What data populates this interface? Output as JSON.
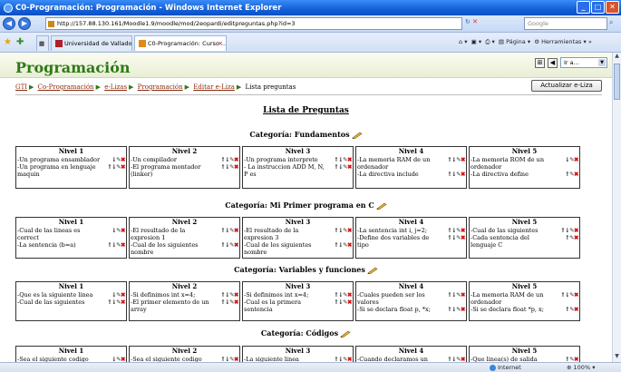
{
  "window": {
    "title": "C0-Programación: Programación - Windows Internet Explorer"
  },
  "address": {
    "url": "http://157.88.130.161/Moodle1.9/moodle/mod/2eopardi/editpreguntas.php?id=3",
    "search_placeholder": "Google"
  },
  "tabs": [
    {
      "label": "Universidad de Valladolid"
    },
    {
      "label": "C0-Programación: Curso ..."
    }
  ],
  "toolbar": {
    "page_label": "Página",
    "tools_label": "Herramientas"
  },
  "header": {
    "course_title": "Programación",
    "jump_select": "Ir a..."
  },
  "breadcrumb": {
    "items": [
      "GTI",
      "Co-Programación",
      "e-Lizas",
      "Programación",
      "Editar e-Liza"
    ],
    "current": "Lista preguntas"
  },
  "update_button": "Actualizar e-Liza",
  "list_title": "Lista de Preguntas",
  "status": {
    "zone": "Internet",
    "zoom": "100%"
  },
  "categories": [
    {
      "title": "Categoría: Fundamentos",
      "levels": [
        {
          "name": "Nivel 1",
          "questions": [
            "-Un programa ensamblador",
            "-Un programa en lenguaje maquin"
          ]
        },
        {
          "name": "Nivel 2",
          "questions": [
            "-Un compilador",
            "-El programa montador (linker)"
          ]
        },
        {
          "name": "Nivel 3",
          "questions": [
            "-Un programa interprete",
            "- La instruccion ADD M, N, P es"
          ]
        },
        {
          "name": "Nivel 4",
          "questions": [
            "-La memoria RAM de un ordenador",
            "-La directiva include"
          ]
        },
        {
          "name": "Nivel 5",
          "questions": [
            "-La memoria ROM de un ordenador",
            "-La directiva define"
          ]
        }
      ]
    },
    {
      "title": "Categoría: Mi Primer programa en C",
      "levels": [
        {
          "name": "Nivel 1",
          "questions": [
            "-Cual de las lineas es correct",
            "-La sentencia (b=a)"
          ]
        },
        {
          "name": "Nivel 2",
          "questions": [
            "-El resultado de la expresion 1",
            "-Cual de los siguientes nombre"
          ]
        },
        {
          "name": "Nivel 3",
          "questions": [
            "-El resultado de la expresion 3",
            "-Cual de los siguientes nombre"
          ]
        },
        {
          "name": "Nivel 4",
          "questions": [
            "-La sentencia int i, j=2;",
            "-Define dos variables de tipo"
          ]
        },
        {
          "name": "Nivel 5",
          "questions": [
            "-Cual de las siguientes",
            "-Cada sentencia del lenguaje C"
          ]
        }
      ]
    },
    {
      "title": "Categoría: Variables y funciones",
      "levels": [
        {
          "name": "Nivel 1",
          "questions": [
            "-Que es la siguiente linea",
            "-Cual de las siguientes"
          ]
        },
        {
          "name": "Nivel 2",
          "questions": [
            "-Si definimos int x=4;",
            "-El primer elemento de un array"
          ]
        },
        {
          "name": "Nivel 3",
          "questions": [
            "-Si definimos int x=4;",
            "-Cual es la primera sentencia"
          ]
        },
        {
          "name": "Nivel 4",
          "questions": [
            "-Cuales pueden ser los valores",
            "-Si se declara float p, *x;"
          ]
        },
        {
          "name": "Nivel 5",
          "questions": [
            "-La memoria RAM de un ordenador",
            "-Si se declara float *p, x;"
          ]
        }
      ]
    },
    {
      "title": "Categoría: Códigos",
      "levels": [
        {
          "name": "Nivel 1",
          "questions": [
            "-Sea el siguiente codigo"
          ]
        },
        {
          "name": "Nivel 2",
          "questions": [
            "-Sea el siguiente codigo"
          ]
        },
        {
          "name": "Nivel 3",
          "questions": [
            "-La siguiente linea"
          ]
        },
        {
          "name": "Nivel 4",
          "questions": [
            "-Cuando declaramos un array:"
          ]
        },
        {
          "name": "Nivel 5",
          "questions": [
            "-Que linea(s) de salida"
          ]
        }
      ]
    }
  ]
}
